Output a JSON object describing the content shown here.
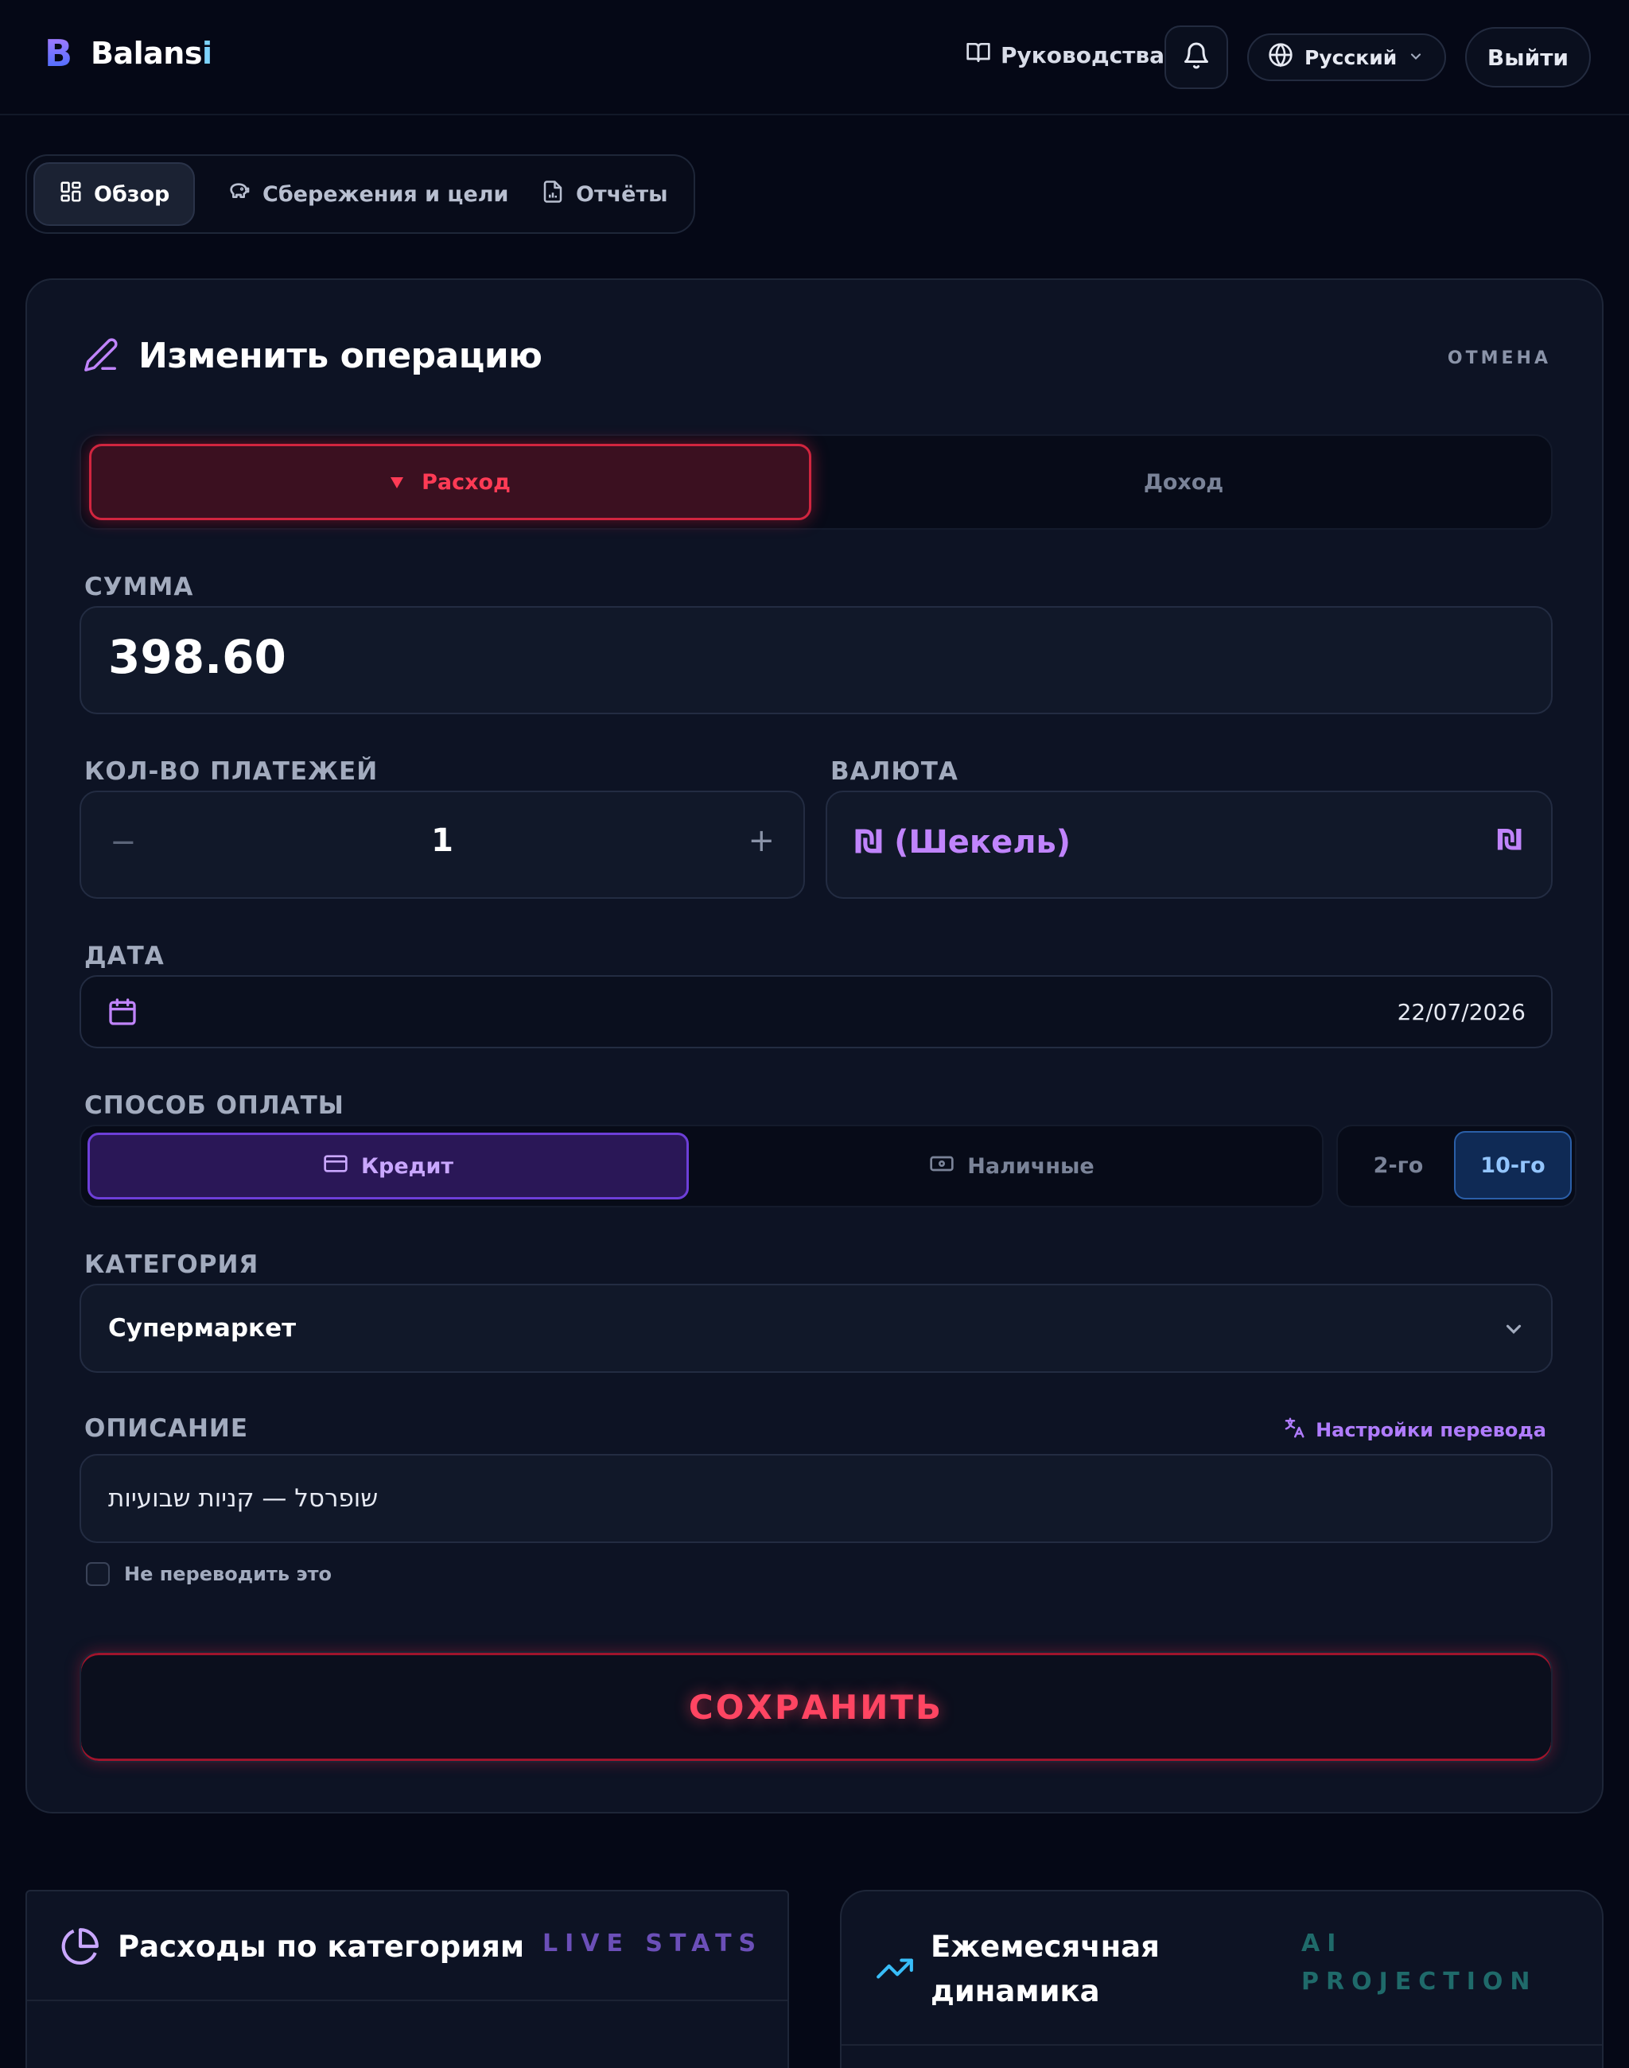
{
  "header": {
    "brand": {
      "letter": "B",
      "name_main": "Balans",
      "name_accent": "i"
    },
    "guides_label": "Руководства",
    "language_label": "Русский",
    "logout_label": "Выйти"
  },
  "tabs": [
    {
      "label": "Обзор",
      "active": true,
      "icon": "grid-icon"
    },
    {
      "label": "Сбережения и цели",
      "active": false,
      "icon": "piggy-bank-icon"
    },
    {
      "label": "Отчёты",
      "active": false,
      "icon": "report-file-icon"
    }
  ],
  "form": {
    "title": "Изменить операцию",
    "cancel_label": "ОТМЕНА",
    "type_toggle": {
      "expense_label": "Расход",
      "income_label": "Доход",
      "selected": "expense"
    },
    "amount": {
      "label": "СУММА",
      "value": "398.60"
    },
    "payments": {
      "label": "КОЛ-ВО ПЛАТЕЖЕЙ",
      "minus": "−",
      "value": "1",
      "plus": "+"
    },
    "currency": {
      "label": "ВАЛЮТА",
      "value": "₪ (Шекель)",
      "symbol": "₪"
    },
    "date": {
      "label": "ДАТА",
      "value": "22/07/2026"
    },
    "payment_method": {
      "label": "СПОСОБ ОПЛАТЫ",
      "credit_label": "Кредит",
      "cash_label": "Наличные",
      "selected": "credit",
      "cycle_options": [
        "2-го",
        "10-го"
      ],
      "cycle_selected": "10-го"
    },
    "category": {
      "label": "КАТЕГОРИЯ",
      "value": "Супермаркет"
    },
    "description": {
      "label": "ОПИСАНИЕ",
      "translate_link": "Настройки перевода",
      "value": "שופרסל — קניות שבועיות",
      "no_translate_label": "Не переводить это",
      "no_translate_checked": false
    },
    "save_label": "СОХРАНИТЬ"
  },
  "bottom_cards": {
    "left": {
      "title": "Расходы по категориям",
      "tag": "LIVE STATS"
    },
    "right": {
      "title_line1": "Ежемесячная",
      "title_line2": "динамика",
      "tag_line1": "AI",
      "tag_line2": "PROJECTION"
    }
  },
  "colors": {
    "background": "#050816",
    "card": "#0d1324",
    "expense_accent": "#ff3b55",
    "credit_accent": "#c9a7ff",
    "currency_accent": "#c084fc",
    "cycle_accent": "#93c5fd",
    "live_stats_tag": "#6b4fb8",
    "ai_projection_tag": "#1f6a6a"
  }
}
